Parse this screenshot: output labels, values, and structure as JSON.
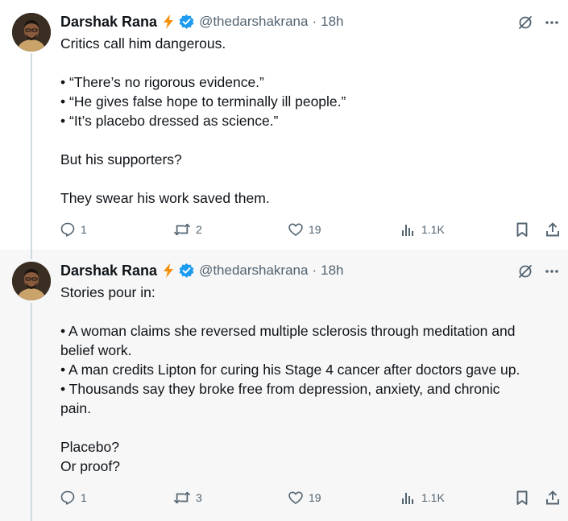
{
  "tweets": [
    {
      "author": {
        "name": "Darshak Rana",
        "handle": "@thedarshakrana",
        "time": "18h"
      },
      "body": [
        "Critics call him dangerous.",
        "",
        "• “There’s no rigorous evidence.”",
        "• “He gives false hope to terminally ill people.”",
        "• “It’s placebo dressed as science.”",
        "",
        "But his supporters?",
        "",
        "They swear his work saved them."
      ],
      "stats": {
        "replies": "1",
        "reposts": "2",
        "likes": "19",
        "views": "1.1K"
      }
    },
    {
      "author": {
        "name": "Darshak Rana",
        "handle": "@thedarshakrana",
        "time": "18h"
      },
      "body": [
        "Stories pour in:",
        "",
        "• A woman claims she reversed multiple sclerosis through meditation and",
        "belief work.",
        "• A man credits Lipton for curing his Stage 4 cancer after doctors gave up.",
        "• Thousands say they broke free from depression, anxiety, and chronic",
        "pain.",
        "",
        "Placebo?",
        "Or proof?"
      ],
      "stats": {
        "replies": "1",
        "reposts": "3",
        "likes": "19",
        "views": "1.1K"
      }
    }
  ],
  "separator": "·",
  "icons": {
    "bolt": "lightning-bolt-emoji",
    "verified": "verified-badge-icon",
    "grok": "grok-icon",
    "more": "more-icon",
    "reply": "reply-icon",
    "repost": "repost-icon",
    "like": "like-icon",
    "views": "views-icon",
    "bookmark": "bookmark-icon",
    "share": "share-icon"
  },
  "colors": {
    "text": "#0f1419",
    "secondary": "#536471",
    "verified": "#1d9bf0",
    "bolt": "#f4900c",
    "thread_line": "#cfd9de"
  }
}
